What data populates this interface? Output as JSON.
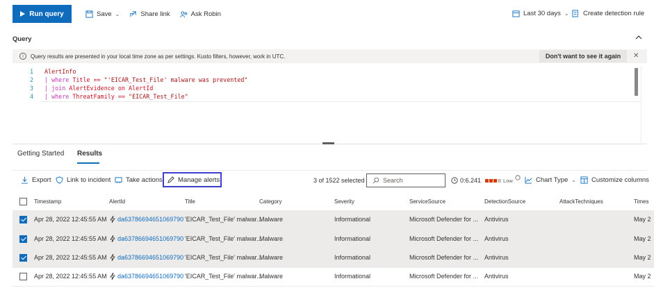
{
  "toolbar": {
    "run_query": "Run query",
    "save": "Save",
    "share_link": "Share link",
    "ask_robin": "Ask Robin",
    "time_range": "Last 30 days",
    "create_rule": "Create detection rule"
  },
  "query": {
    "title": "Query",
    "info_text": "Query results are presented in your local time zone as per settings. Kusto filters, however, work in UTC.",
    "dismiss_label": "Don't want to see it again",
    "lines": [
      {
        "num": "1",
        "a": "AlertInfo",
        "b": "",
        "c": ""
      },
      {
        "num": "2",
        "a": "| where ",
        "b": "Title == ",
        "c": "\"'EICAR_Test_File' malware was prevented\""
      },
      {
        "num": "3",
        "a": "| join ",
        "b": "AlertEvidence on AlertId",
        "c": ""
      },
      {
        "num": "4",
        "a": "| where ",
        "b": "ThreatFamily == ",
        "c": "\"EICAR_Test_File\""
      }
    ]
  },
  "tabs": {
    "getting_started": "Getting Started",
    "results": "Results"
  },
  "results_toolbar": {
    "export": "Export",
    "link_incident": "Link to incident",
    "take_actions": "Take actions",
    "manage_alerts": "Manage alerts",
    "selected": "3 of 1522 selected",
    "search_placeholder": "Search",
    "timer": "0:6.241",
    "low": "Low",
    "chart_type": "Chart Type",
    "customize_columns": "Customize columns"
  },
  "table": {
    "headers": {
      "timestamp": "Timestamp",
      "alertid": "AlertId",
      "title": "Title",
      "category": "Category",
      "severity": "Severity",
      "servicesource": "ServiceSource",
      "detectionsource": "DetectionSource",
      "attacktechniques": "AttackTechniques",
      "times": "Times"
    },
    "rows": [
      {
        "timestamp": "Apr 28, 2022 12:45:55 AM",
        "alertid": "da637866946510697​90",
        "title": "'EICAR_Test_File' malwar...",
        "category": "Malware",
        "severity": "Informational",
        "servicesource": "Microsoft Defender for ...",
        "detectionsource": "Antivirus",
        "times": "May 2"
      },
      {
        "timestamp": "Apr 28, 2022 12:45:55 AM",
        "alertid": "da63786694651069790",
        "title": "'EICAR_Test_File' malwar...",
        "category": "Malware",
        "severity": "Informational",
        "servicesource": "Microsoft Defender for ...",
        "detectionsource": "Antivirus",
        "times": "May 2"
      },
      {
        "timestamp": "Apr 28, 2022 12:45:55 AM",
        "alertid": "da63786694651069790",
        "title": "'EICAR_Test_File' malwar...",
        "category": "Malware",
        "severity": "Informational",
        "servicesource": "Microsoft Defender for ...",
        "detectionsource": "Antivirus",
        "times": "May 2"
      },
      {
        "timestamp": "Apr 28, 2022 12:45:55 AM",
        "alertid": "da63786694651069790",
        "title": "'EICAR_Test_File' malwar...",
        "category": "Malware",
        "severity": "Informational",
        "servicesource": "Microsoft Defender for ...",
        "detectionsource": "Antivirus",
        "times": "May 2"
      }
    ],
    "selected_rows": [
      true,
      true,
      true,
      false
    ]
  },
  "colors": {
    "accent": "#0f6cbd",
    "highlight_box": "#3b3fc9",
    "low_bar": "#d83b01"
  }
}
